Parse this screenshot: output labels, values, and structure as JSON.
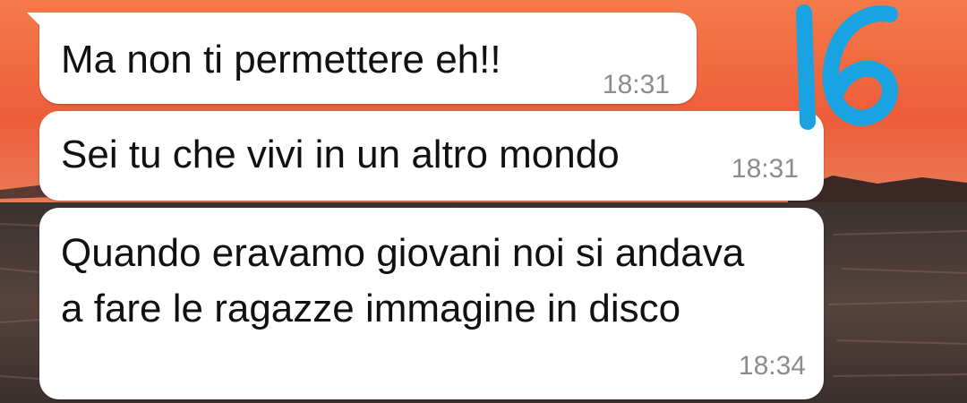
{
  "colors": {
    "sky_top": "#f06a45",
    "sky_mid": "#f0603c",
    "sky_low": "#e2744e",
    "sea": "#3d3532",
    "bubble": "#ffffff",
    "sticker_blue": "#1aa3e3"
  },
  "messages": [
    {
      "text": "Ma non ti permettere eh!!",
      "time": "18:31"
    },
    {
      "text": "Sei tu che vivi in un altro mondo",
      "time": "18:31"
    },
    {
      "text": "Quando eravamo giovani noi si andava\na fare le ragazze immagine in disco",
      "time": "18:34"
    }
  ],
  "sticker": {
    "icon": "number-sticker-icon",
    "text": "16"
  }
}
